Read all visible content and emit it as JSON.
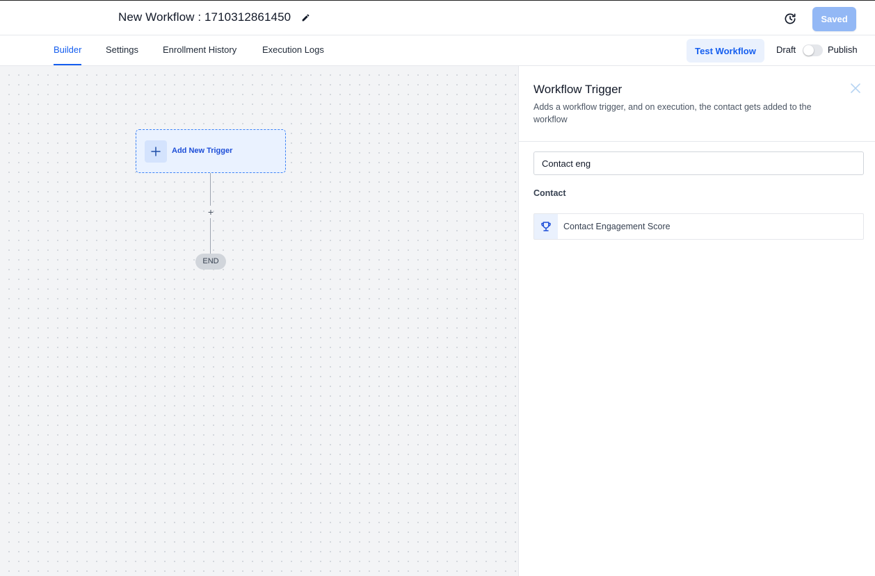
{
  "header": {
    "workflow_title": "New Workflow : 1710312861450",
    "saved_label": "Saved"
  },
  "tabs": [
    {
      "label": "Builder",
      "active": true
    },
    {
      "label": "Settings",
      "active": false
    },
    {
      "label": "Enrollment History",
      "active": false
    },
    {
      "label": "Execution Logs",
      "active": false
    }
  ],
  "actions": {
    "test_label": "Test Workflow",
    "draft_label": "Draft",
    "publish_label": "Publish",
    "published": false
  },
  "canvas": {
    "trigger_label": "Add New Trigger",
    "end_label": "END"
  },
  "panel": {
    "title": "Workflow Trigger",
    "description": "Adds a workflow trigger, and on execution, the contact gets added to the workflow",
    "search_value": "Contact eng",
    "section_label": "Contact",
    "results": [
      {
        "label": "Contact Engagement Score",
        "icon": "trophy-icon"
      }
    ]
  },
  "colors": {
    "accent": "#155eef",
    "saved_button": "#93b8f5",
    "canvas_bg": "#f3f4f6"
  }
}
